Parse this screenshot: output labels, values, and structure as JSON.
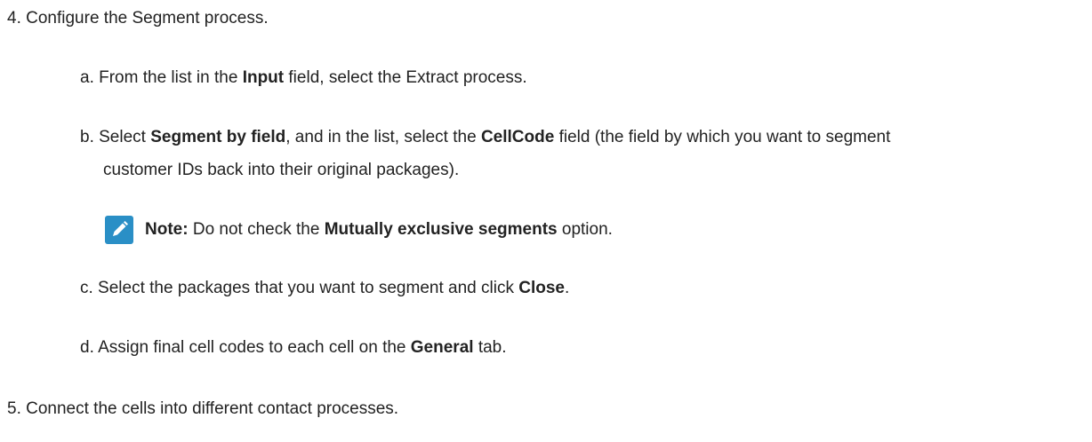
{
  "steps": {
    "step4": {
      "label": "4. Configure the Segment process.",
      "a": {
        "prefix": "a. From the list in the ",
        "bold1": "Input",
        "suffix": " field, select the Extract process."
      },
      "b": {
        "prefix": "b. Select ",
        "bold1": "Segment by field",
        "mid1": ", and in the list, select the ",
        "bold2": "CellCode",
        "suffix": " field (the field by which you want to segment",
        "line2": "customer IDs back into their original packages)."
      },
      "note": {
        "icon": "pencil-note-icon",
        "label": "Note:",
        "mid": " Do not check the ",
        "bold": "Mutually exclusive segments",
        "suffix": " option."
      },
      "c": {
        "prefix": "c. Select the packages that you want to segment and click ",
        "bold1": "Close",
        "suffix": "."
      },
      "d": {
        "prefix": "d. Assign final cell codes to each cell on the ",
        "bold1": "General",
        "suffix": " tab."
      }
    },
    "step5": {
      "label": "5. Connect the cells into different contact processes."
    }
  },
  "colors": {
    "text": "#222222",
    "note_icon_bg": "#2a8fc6"
  }
}
